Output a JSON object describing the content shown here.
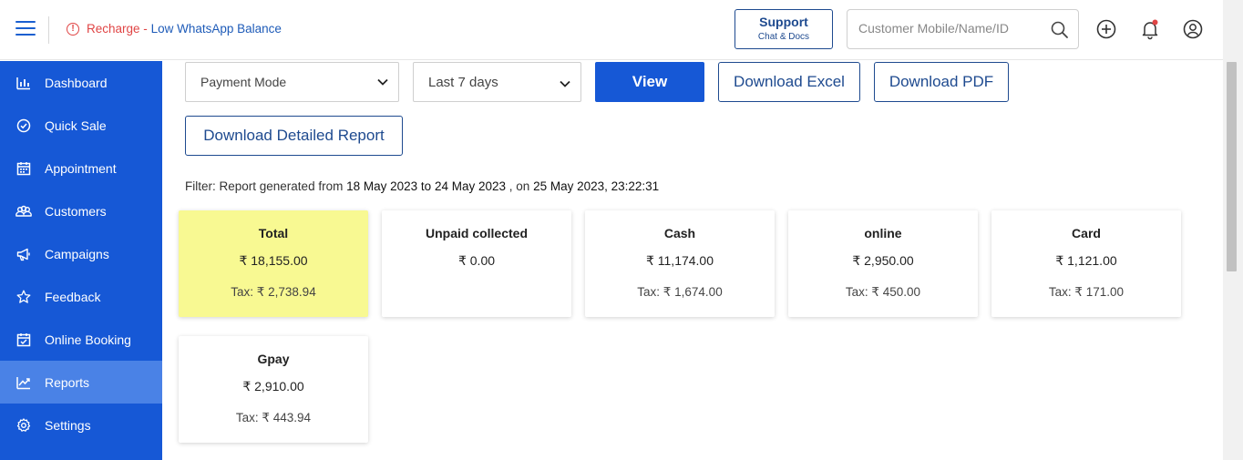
{
  "topbar": {
    "recharge_red": "Recharge -",
    "recharge_blue": "Low WhatsApp Balance",
    "support_title": "Support",
    "support_sub": "Chat & Docs",
    "search_placeholder": "Customer Mobile/Name/ID",
    "icons": [
      "menu-icon",
      "info-icon",
      "search-icon",
      "add-circle-icon",
      "bell-icon",
      "user-circle-icon"
    ]
  },
  "sidebar": {
    "items": [
      {
        "label": "Dashboard",
        "icon": "bar-chart-icon"
      },
      {
        "label": "Quick Sale",
        "icon": "check-circle-icon"
      },
      {
        "label": "Appointment",
        "icon": "calendar-icon"
      },
      {
        "label": "Customers",
        "icon": "users-icon"
      },
      {
        "label": "Campaigns",
        "icon": "megaphone-icon"
      },
      {
        "label": "Feedback",
        "icon": "star-icon"
      },
      {
        "label": "Online Booking",
        "icon": "calendar-check-icon"
      },
      {
        "label": "Reports",
        "icon": "line-chart-icon",
        "active": true
      },
      {
        "label": "Settings",
        "icon": "gear-icon"
      }
    ]
  },
  "controls": {
    "payment_mode": "Payment Mode",
    "date_range": "Last 7 days",
    "view": "View",
    "download_excel": "Download Excel",
    "download_pdf": "Download PDF",
    "download_detailed": "Download Detailed Report"
  },
  "filter": {
    "prefix": "Filter: Report generated from",
    "from": "18 May 2023",
    "to_word": "to",
    "to": "24 May 2023",
    "on_word": ", on",
    "on": "25 May 2023, 23:22:31"
  },
  "cards": [
    {
      "title": "Total",
      "amount": "₹ 18,155.00",
      "tax": "Tax: ₹ 2,738.94",
      "highlight": true
    },
    {
      "title": "Unpaid collected",
      "amount": "₹ 0.00",
      "tax": ""
    },
    {
      "title": "Cash",
      "amount": "₹ 11,174.00",
      "tax": "Tax: ₹ 1,674.00"
    },
    {
      "title": "online",
      "amount": "₹ 2,950.00",
      "tax": "Tax: ₹ 450.00"
    },
    {
      "title": "Card",
      "amount": "₹ 1,121.00",
      "tax": "Tax: ₹ 171.00"
    },
    {
      "title": "Gpay",
      "amount": "₹ 2,910.00",
      "tax": "Tax: ₹ 443.94"
    }
  ],
  "colors": {
    "sidebar": "#1658d6",
    "sidebar_active": "#4a82e6",
    "primary": "#1658d6",
    "outline": "#1e4a8f",
    "alert": "#e04545",
    "highlight_card": "#f8f992"
  }
}
